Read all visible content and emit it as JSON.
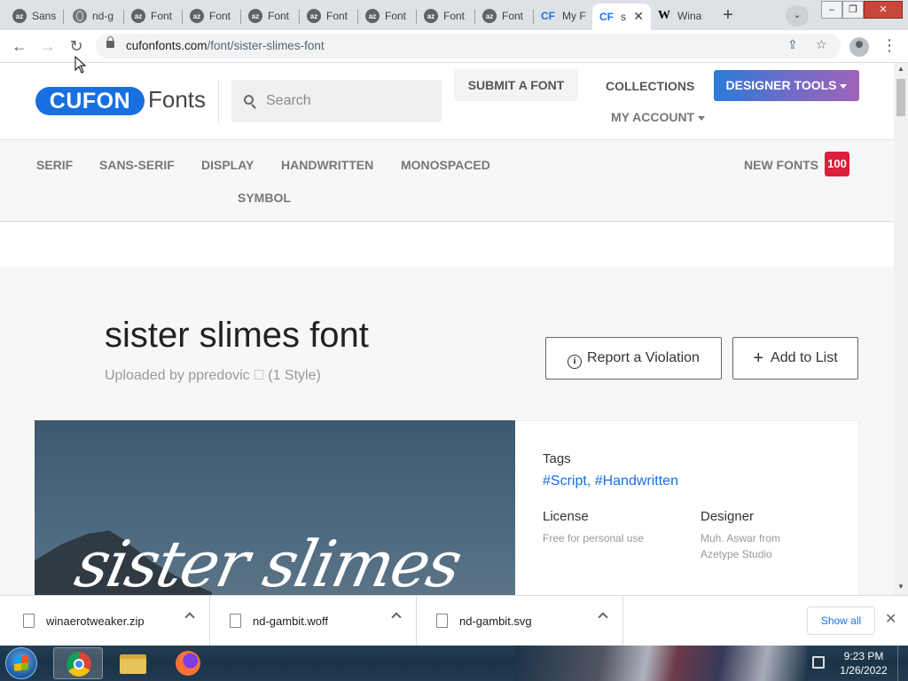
{
  "browser": {
    "tabs": [
      {
        "label": "Sans",
        "icon": "az-icon"
      },
      {
        "label": "nd-g",
        "icon": "globe-icon"
      },
      {
        "label": "Font",
        "icon": "az-icon"
      },
      {
        "label": "Font",
        "icon": "az-icon"
      },
      {
        "label": "Font",
        "icon": "az-icon"
      },
      {
        "label": "Font",
        "icon": "az-icon"
      },
      {
        "label": "Font",
        "icon": "az-icon"
      },
      {
        "label": "Font",
        "icon": "az-icon"
      },
      {
        "label": "Font",
        "icon": "az-icon"
      },
      {
        "label": "My F",
        "icon": "cf-icon"
      },
      {
        "label": "s",
        "icon": "cf-icon",
        "active": true
      },
      {
        "label": "Wina",
        "icon": "w-icon"
      }
    ],
    "url_host": "cufonfonts.com",
    "url_path": "/font/sister-slimes-font"
  },
  "site": {
    "logo_pill": "CUFON",
    "logo_word": "Fonts",
    "search_placeholder": "Search",
    "nav": {
      "submit": "SUBMIT A FONT",
      "collections": "COLLECTIONS",
      "designer_tools": "DESIGNER TOOLS",
      "my_account": "MY ACCOUNT"
    },
    "categories": [
      "SERIF",
      "SANS-SERIF",
      "DISPLAY",
      "HANDWRITTEN",
      "MONOSPACED",
      "SYMBOL"
    ],
    "new_fonts_label": "NEW FONTS",
    "new_fonts_count": "100"
  },
  "font_page": {
    "title": "sister slimes font",
    "uploaded": "Uploaded by ppredovic 🗆 (1 Style)",
    "report_button": "Report a Violation",
    "add_list_button": "Add to List",
    "preview_text": "sister slimes",
    "tags_heading": "Tags",
    "tags": "#Script, #Handwritten",
    "license_heading": "License",
    "license_value": "Free for personal use",
    "designer_heading": "Designer",
    "designer_value_line1": "Muh. Aswar from",
    "designer_value_line2": "Azetype Studio"
  },
  "downloads": {
    "items": [
      "winaerotweaker.zip",
      "nd-gambit.woff",
      "nd-gambit.svg"
    ],
    "show_all": "Show all"
  },
  "taskbar": {
    "time": "9:23 PM",
    "date": "1/26/2022"
  },
  "colors": {
    "brand_blue": "#1a6fe0",
    "badge_red": "#dc1f3a",
    "link_blue": "#1a73e8"
  }
}
